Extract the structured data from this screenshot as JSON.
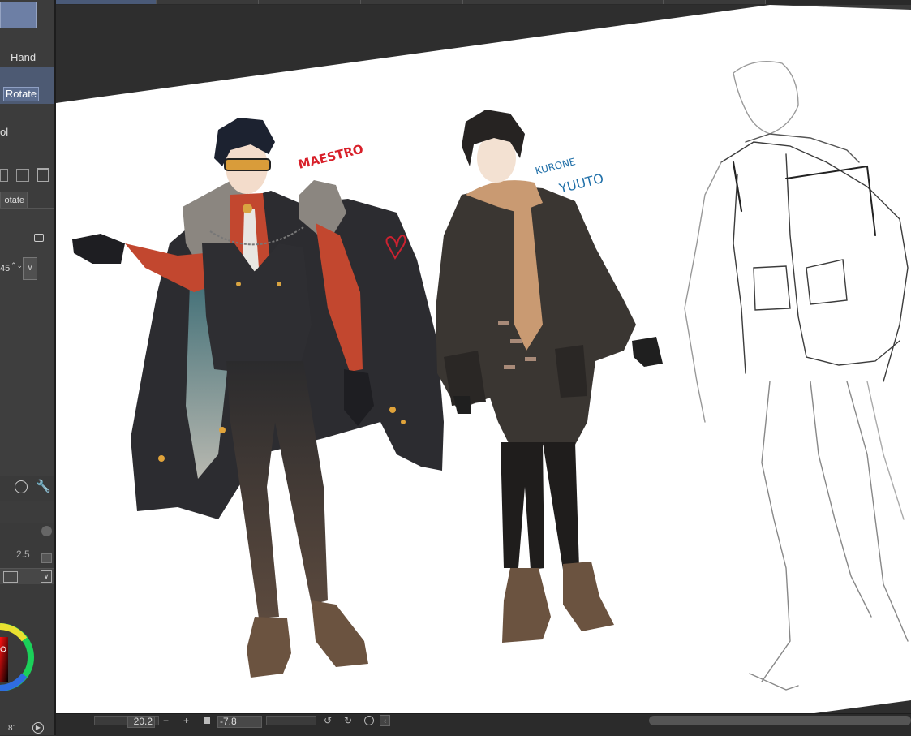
{
  "left_panel": {
    "tool_hand": "Hand",
    "tool_rotate": "Rotate",
    "tool_partial": "ol",
    "sub_tab": "otate",
    "angle_value": "45",
    "brush_size": "2.5",
    "color_readout": "81"
  },
  "canvas": {
    "label_maestro": "MAESTRO",
    "label_kurone": "KURONE",
    "label_yuuto": "YUUTO"
  },
  "status_bar": {
    "zoom": "20.2",
    "minus": "−",
    "plus": "+",
    "rotation": "-7.8"
  },
  "colors": {
    "maestro_label": "#d8202a",
    "kurone_label": "#1f6fa8",
    "heart": "#cc2230",
    "canvas_bg": "#ffffff",
    "workspace_bg": "#2e2e2e"
  }
}
